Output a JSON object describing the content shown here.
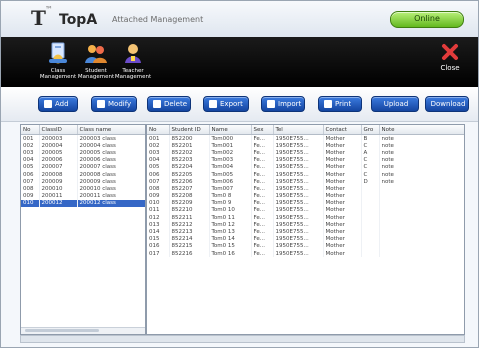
{
  "header": {
    "logo_letter": "T",
    "logo_sup": "™",
    "brand": "TopA",
    "subtitle": "Attached Management",
    "status_pill": "Online"
  },
  "modules": [
    {
      "label": "Class Management",
      "icon": "class-icon"
    },
    {
      "label": "Student Management",
      "icon": "student-icon"
    },
    {
      "label": "Teacher Management",
      "icon": "teacher-icon"
    }
  ],
  "close": {
    "label": "Close",
    "icon": "close-icon"
  },
  "toolbar": {
    "add": "Add",
    "modify": "Modify",
    "delete": "Delete",
    "export": "Export",
    "import": "Import",
    "print": "Print",
    "upload": "Upload",
    "download": "Download"
  },
  "colors": {
    "accent": "#1f56bd",
    "status": "#63b81e",
    "module_bar": "#0d0d0d"
  },
  "class_table": {
    "columns": [
      "No",
      "ClassID",
      "Class name"
    ],
    "rows": [
      [
        "001",
        "200003",
        "200003 class"
      ],
      [
        "002",
        "200004",
        "200004 class"
      ],
      [
        "003",
        "200005",
        "200005 class"
      ],
      [
        "004",
        "200006",
        "200006 class"
      ],
      [
        "005",
        "200007",
        "200007 class"
      ],
      [
        "006",
        "200008",
        "200008 class"
      ],
      [
        "007",
        "200009",
        "200009 class"
      ],
      [
        "008",
        "200010",
        "200010 class"
      ],
      [
        "009",
        "200011",
        "200011 class"
      ],
      [
        "010",
        "200012",
        "200012 class"
      ]
    ],
    "selected_index": 9
  },
  "student_table": {
    "columns": [
      "No",
      "Student ID",
      "Name",
      "Sex",
      "Tel",
      "Contact",
      "Gro",
      "Note"
    ],
    "rows": [
      [
        "001",
        "852200",
        "Tom000",
        "Fe...",
        "1950E755...",
        "Mother",
        "B",
        "note"
      ],
      [
        "002",
        "852201",
        "Tom001",
        "Fe...",
        "1950E755...",
        "Mother",
        "C",
        "note"
      ],
      [
        "003",
        "852202",
        "Tom002",
        "Fe...",
        "1950E755...",
        "Mother",
        "A",
        "note"
      ],
      [
        "004",
        "852203",
        "Tom003",
        "Fe...",
        "1950E755...",
        "Mother",
        "C",
        "note"
      ],
      [
        "005",
        "852204",
        "Tom004",
        "Fe...",
        "1950E755...",
        "Mother",
        "C",
        "note"
      ],
      [
        "006",
        "852205",
        "Tom005",
        "Fe...",
        "1950E755...",
        "Mother",
        "C",
        "note"
      ],
      [
        "007",
        "852206",
        "Tom006",
        "Fe...",
        "1950E755...",
        "Mother",
        "D",
        "note"
      ],
      [
        "008",
        "852207",
        "Tom007",
        "Fe...",
        "1950E755...",
        "Mother",
        "",
        ""
      ],
      [
        "009",
        "852208",
        "Tom0 8",
        "Fe...",
        "1950E755...",
        "Mother",
        "",
        ""
      ],
      [
        "010",
        "852209",
        "Tom0 9",
        "Fe...",
        "1950E755...",
        "Mother",
        "",
        ""
      ],
      [
        "011",
        "852210",
        "Tom0 10",
        "Fe...",
        "1950E755...",
        "Mother",
        "",
        ""
      ],
      [
        "012",
        "852211",
        "Tom0 11",
        "Fe...",
        "1950E755...",
        "Mother",
        "",
        ""
      ],
      [
        "013",
        "852212",
        "Tom0 12",
        "Fe...",
        "1950E755...",
        "Mother",
        "",
        ""
      ],
      [
        "014",
        "852213",
        "Tom0 13",
        "Fe...",
        "1950E755...",
        "Mother",
        "",
        ""
      ],
      [
        "015",
        "852214",
        "Tom0 14",
        "Fe...",
        "1950E755...",
        "Mother",
        "",
        ""
      ],
      [
        "016",
        "852215",
        "Tom0 15",
        "Fe...",
        "1950E755...",
        "Mother",
        "",
        ""
      ],
      [
        "017",
        "852216",
        "Tom0 16",
        "Fe...",
        "1950E755...",
        "Mother",
        "",
        ""
      ]
    ]
  }
}
